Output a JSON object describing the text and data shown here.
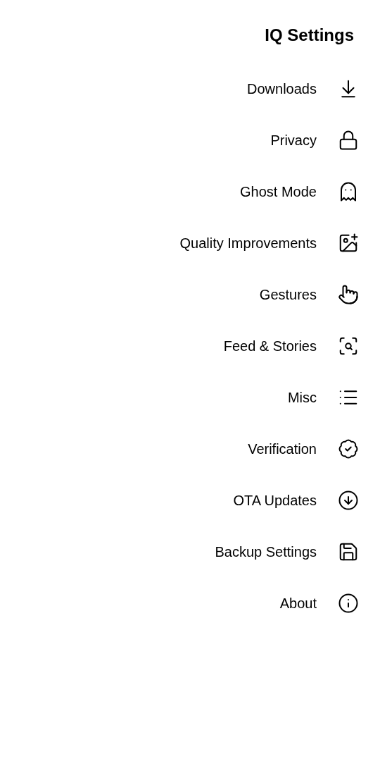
{
  "title": "IQ Settings",
  "items": [
    {
      "label": "Downloads"
    },
    {
      "label": "Privacy"
    },
    {
      "label": "Ghost Mode"
    },
    {
      "label": "Quality Improvements"
    },
    {
      "label": "Gestures"
    },
    {
      "label": "Feed & Stories"
    },
    {
      "label": "Misc"
    },
    {
      "label": "Verification"
    },
    {
      "label": "OTA Updates"
    },
    {
      "label": "Backup Settings"
    },
    {
      "label": "About"
    }
  ]
}
